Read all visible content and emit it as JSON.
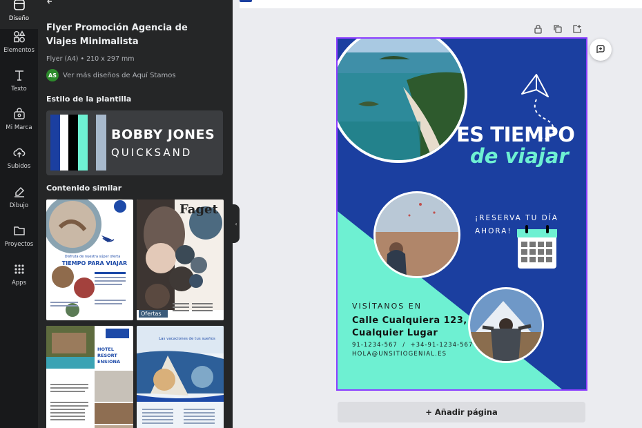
{
  "rail": [
    {
      "label": "Diseño",
      "icon": "design-icon"
    },
    {
      "label": "Elementos",
      "icon": "shapes-icon"
    },
    {
      "label": "Texto",
      "icon": "text-icon"
    },
    {
      "label": "Mi Marca",
      "icon": "brand-icon"
    },
    {
      "label": "Subidos",
      "icon": "upload-icon"
    },
    {
      "label": "Dibujo",
      "icon": "draw-icon"
    },
    {
      "label": "Proyectos",
      "icon": "folder-icon"
    },
    {
      "label": "Apps",
      "icon": "apps-icon"
    }
  ],
  "panel": {
    "title": "Flyer Promoción Agencia de Viajes Minimalista",
    "meta": "Flyer (A4) • 210 x 297 mm",
    "author_initials": "AS",
    "author_text": "Ver más diseños de Aquí Stamos",
    "style_heading": "Estilo de la plantilla",
    "style_font1": "BOBBY JONES",
    "style_font2": "QUICKSAND",
    "palette": [
      "#1b3fa0",
      "#ffffff",
      "#000000",
      "#6ef0d2",
      "#a7b9cc"
    ],
    "similar_heading": "Contenido similar",
    "thumbs": {
      "t1_title": "TIEMPO PARA VIAJAR",
      "t1_sub": "Disfruta de nuestra súper oferta",
      "t2_title": "Faget",
      "t2_label": "Ofertas",
      "t3_title": "HOTEL RESORT ENSIONA",
      "t4_title": "Las vacaciones de tus sueños"
    }
  },
  "canvas": {
    "add_page": "+ Añadir página"
  },
  "flyer": {
    "headline1": "ES TIEMPO",
    "headline2": "de viajar",
    "reserve1": "¡RESERVA TU DÍA",
    "reserve2": "AHORA!",
    "visit": "VISÍTANOS EN",
    "address1": "Calle Cualquiera 123,",
    "address2": "Cualquier Lugar",
    "phones": "91-1234-567  /  +34-91-1234-567",
    "email": "HOLA@UNSITIOGENIAL.ES"
  },
  "colors": {
    "flyer_blue": "#1b3fa0",
    "flyer_mint": "#6ef0d2",
    "selection": "#8b3dff"
  }
}
